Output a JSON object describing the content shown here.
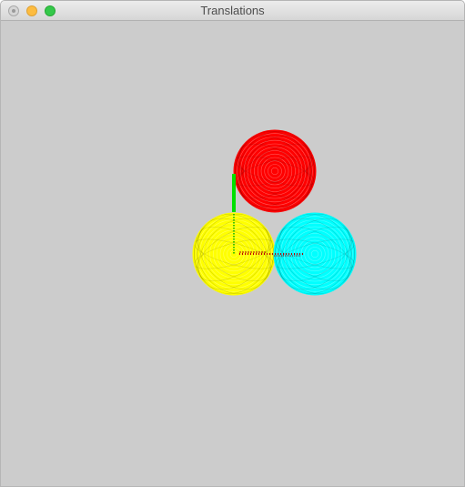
{
  "window": {
    "title": "Translations",
    "buttons": {
      "close_color": "#d6d6d6",
      "minimize_color": "#fdbc40",
      "zoom_color": "#34c84a"
    }
  },
  "scene": {
    "background": "#cccccc",
    "spheres": [
      {
        "name": "red-sphere",
        "color": "#ff0000"
      },
      {
        "name": "yellow-sphere",
        "color": "#ffff00"
      },
      {
        "name": "cyan-sphere",
        "color": "#00ffff"
      }
    ],
    "axes": [
      {
        "name": "y-axis",
        "color": "#00e000"
      },
      {
        "name": "x-axis",
        "color": "#d00000"
      }
    ]
  }
}
